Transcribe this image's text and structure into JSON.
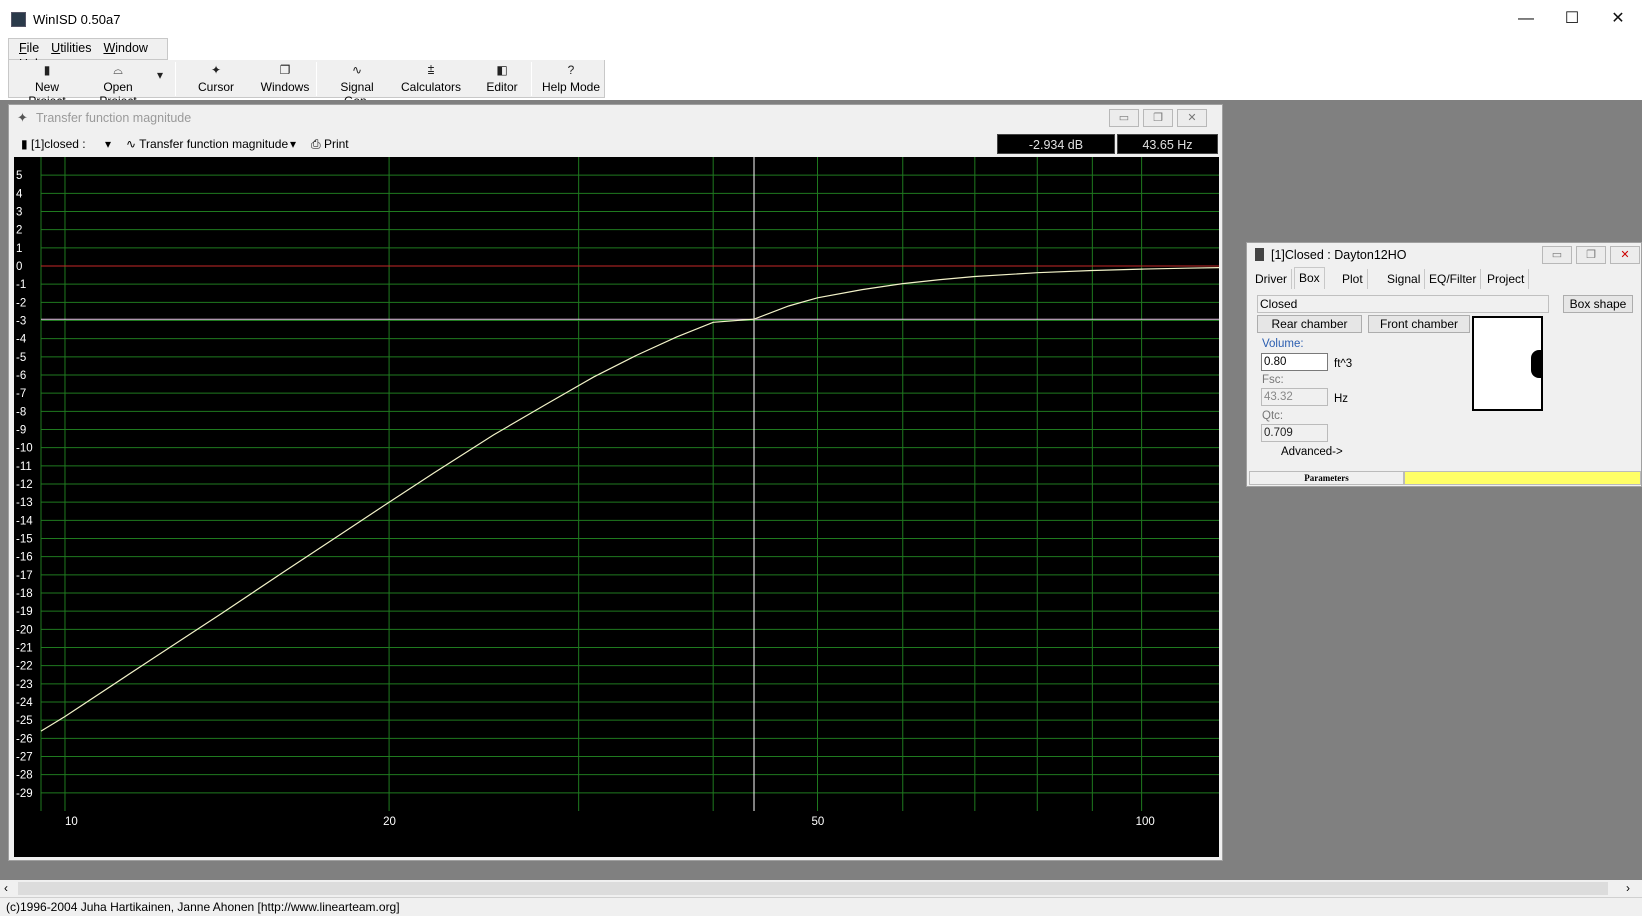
{
  "window": {
    "title": "WinISD 0.50a7",
    "minimize": "—",
    "maximize": "☐",
    "close": "✕"
  },
  "menu": [
    "File",
    "Utilities",
    "Window",
    "Help"
  ],
  "toolbar": {
    "new_project": "New Project",
    "open_project": "Open Project",
    "cursor": "Cursor",
    "windows": "Windows",
    "signal_gen": "Signal Gen.",
    "calculators": "Calculators",
    "editor": "Editor",
    "help_mode": "Help Mode"
  },
  "plot_window": {
    "title": "Transfer function magnitude",
    "project_select": "[1]closed :",
    "plot_select": "Transfer function magnitude",
    "print": "Print",
    "readout_db": "-2.934 dB",
    "readout_hz": "43.65 Hz"
  },
  "chart_data": {
    "type": "line",
    "title": "Transfer function magnitude",
    "xscale": "log",
    "xlim": [
      9.5,
      118
    ],
    "ylim": [
      -30,
      6
    ],
    "x_tick_labels": [
      "10",
      "20",
      "50",
      "100"
    ],
    "y_tick_labels": [
      "5",
      "4",
      "3",
      "2",
      "1",
      "0",
      "-1",
      "-2",
      "-3",
      "-4",
      "-5",
      "-6",
      "-7",
      "-8",
      "-9",
      "-10",
      "-11",
      "-12",
      "-13",
      "-14",
      "-15",
      "-16",
      "-17",
      "-18",
      "-19",
      "-20",
      "-21",
      "-22",
      "-23",
      "-24",
      "-25",
      "-26",
      "-27",
      "-28",
      "-29"
    ],
    "grid": true,
    "series": [
      {
        "x": [
          9.5,
          10,
          12,
          14,
          16,
          18,
          20,
          22,
          25,
          28,
          31,
          34,
          37,
          40,
          43.65,
          47,
          50,
          55,
          60,
          65,
          70,
          80,
          90,
          100,
          110,
          118
        ],
        "y": [
          -25.6,
          -24.8,
          -21.7,
          -19.1,
          -16.8,
          -14.8,
          -13.0,
          -11.4,
          -9.3,
          -7.6,
          -6.1,
          -4.9,
          -3.9,
          -3.1,
          -2.93,
          -2.2,
          -1.75,
          -1.3,
          -0.97,
          -0.75,
          -0.58,
          -0.37,
          -0.25,
          -0.17,
          -0.12,
          -0.09
        ]
      }
    ],
    "reference_line_0db": 0,
    "cursor": {
      "x": 43.65,
      "y": -2.934
    },
    "colors": {
      "background": "#000000",
      "grid": "#1f7a1f",
      "curve": "#f2f2c8",
      "zero_line": "#c62828",
      "cursor": "#ffffff"
    }
  },
  "dialog": {
    "title": "[1]Closed : Dayton12HO",
    "tabs": [
      "Driver",
      "Box",
      "Plot",
      "Signal",
      "EQ/Filter",
      "Project"
    ],
    "box_type": "Closed",
    "box_shape": "Box shape",
    "rear_chamber": "Rear chamber",
    "front_chamber": "Front chamber",
    "volume_label": "Volume:",
    "volume_value": "0.80",
    "volume_unit": "ft^3",
    "fsc_label": "Fsc:",
    "fsc_value": "43.32",
    "fsc_unit": "Hz",
    "qtc_label": "Qtc:",
    "qtc_value": "0.709",
    "advanced": "Advanced->",
    "status_label": "Parameters",
    "status_color": "#ffff66"
  },
  "statusbar": {
    "text": "(c)1996-2004 Juha Hartikainen, Janne Ahonen [http://www.linearteam.org]"
  }
}
